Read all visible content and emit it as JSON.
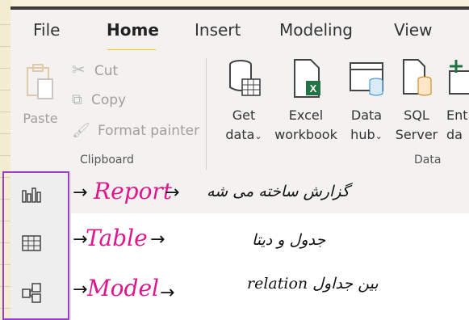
{
  "tabs": [
    "File",
    "Home",
    "Insert",
    "Modeling",
    "View"
  ],
  "clipboard": {
    "paste": "Paste",
    "cut": "Cut",
    "copy": "Copy",
    "format_painter": "Format painter",
    "group": "Clipboard"
  },
  "data_group": {
    "get_data": [
      "Get",
      "data"
    ],
    "excel": [
      "Excel",
      "workbook"
    ],
    "datahub": [
      "Data",
      "hub"
    ],
    "sql": [
      "SQL",
      "Server"
    ],
    "enter": [
      "Ent",
      "da"
    ],
    "group": "Data"
  },
  "notes": {
    "report": "Report",
    "report_fa": "گزارش ساخته می شه",
    "table": "Table",
    "table_fa": "جدول و دیتا",
    "model": "Model",
    "model_fa": "relation بین جداول"
  },
  "colors": {
    "accent": "#f2c811",
    "annotation": "#e0168c",
    "frame": "#9b3ec7",
    "excel": "#217346"
  }
}
